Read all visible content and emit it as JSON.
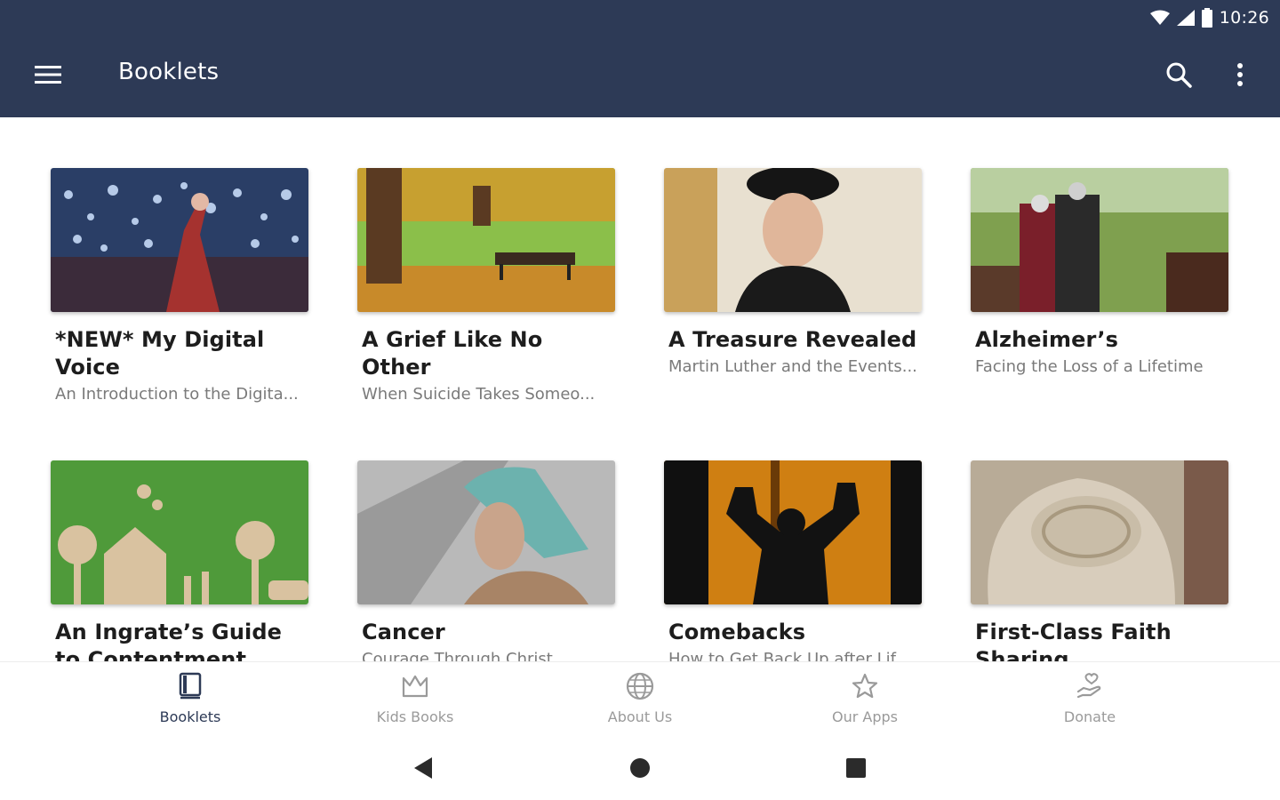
{
  "status": {
    "time": "10:26"
  },
  "appbar": {
    "title": "Booklets"
  },
  "colors": {
    "appbar": "#2d3a56",
    "active_nav": "#2d3a56",
    "inactive_nav": "#9a9a9a"
  },
  "booklets": [
    {
      "title": "*NEW* My Digital Voice",
      "subtitle": "An Introduction to the Digita..."
    },
    {
      "title": "A Grief Like No Other",
      "subtitle": "When Suicide Takes Someo..."
    },
    {
      "title": "A Treasure Revealed",
      "subtitle": "Martin Luther and the Events..."
    },
    {
      "title": "Alzheimer’s",
      "subtitle": "Facing the Loss of a Lifetime"
    },
    {
      "title": "An Ingrate’s Guide to Contentment",
      "subtitle": ""
    },
    {
      "title": "Cancer",
      "subtitle": "Courage Through Christ"
    },
    {
      "title": "Comebacks",
      "subtitle": "How to Get Back Up after Lif..."
    },
    {
      "title": "First-Class Faith Sharing",
      "subtitle": ""
    }
  ],
  "bottom_nav": [
    {
      "label": "Booklets",
      "icon": "book-icon",
      "active": true
    },
    {
      "label": "Kids Books",
      "icon": "crown-icon",
      "active": false
    },
    {
      "label": "About Us",
      "icon": "globe-icon",
      "active": false
    },
    {
      "label": "Our Apps",
      "icon": "star-icon",
      "active": false
    },
    {
      "label": "Donate",
      "icon": "hand-heart-icon",
      "active": false
    }
  ]
}
